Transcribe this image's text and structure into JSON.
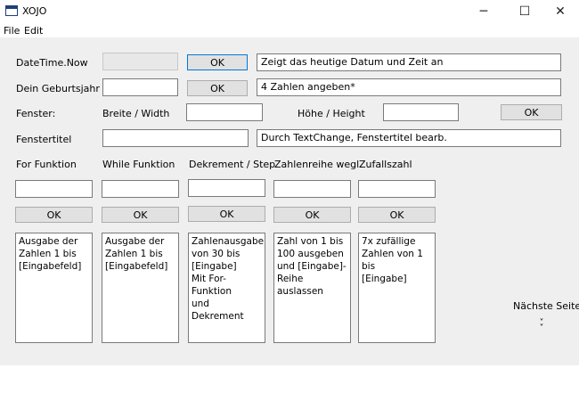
{
  "window": {
    "title": "XOJO",
    "minimize_glyph": "─",
    "maximize_glyph": "☐",
    "close_glyph": "✕"
  },
  "menu": {
    "file": "File",
    "edit": "Edit"
  },
  "row1": {
    "label": "DateTime.Now",
    "input_value": "",
    "ok": "OK",
    "output": "Zeigt das heutige Datum und Zeit an"
  },
  "row2": {
    "label": "Dein Geburtsjahr",
    "input_value": "",
    "ok": "OK",
    "output": "4 Zahlen angeben*"
  },
  "row3": {
    "label": "Fenster:",
    "width_label": "Breite / Width",
    "width_value": "",
    "height_label": "Höhe / Height",
    "height_value": "",
    "ok": "OK"
  },
  "row4": {
    "label": "Fenstertitel",
    "input_value": "",
    "output": "Durch TextChange, Fenstertitel bearb."
  },
  "columns": [
    {
      "header": "For Funktion",
      "input_value": "",
      "ok": "OK",
      "text": "Ausgabe der\nZahlen 1 bis\n[Eingabefeld]"
    },
    {
      "header": "While Funktion",
      "input_value": "",
      "ok": "OK",
      "text": "Ausgabe der\nZahlen 1 bis\n[Eingabefeld]"
    },
    {
      "header": "Dekrement / Step",
      "input_value": "",
      "ok": "OK",
      "text": "Zahlenausgabe\nvon 30 bis\n[Eingabe]\nMit For-Funktion\nund Dekrement"
    },
    {
      "header": "Zahlenreihe wegl.",
      "input_value": "",
      "ok": "OK",
      "text": "Zahl von 1 bis\n100  ausgeben\nund [Eingabe]-\nReihe auslassen"
    },
    {
      "header": "Zufallszahl",
      "input_value": "",
      "ok": "OK",
      "text": "7x zufällige\nZahlen von 1 bis\n[Eingabe]"
    }
  ],
  "next_page": {
    "label": "Nächste Seite",
    "icon": "double-chevron-down-icon",
    "glyph": "˅\n˅"
  }
}
